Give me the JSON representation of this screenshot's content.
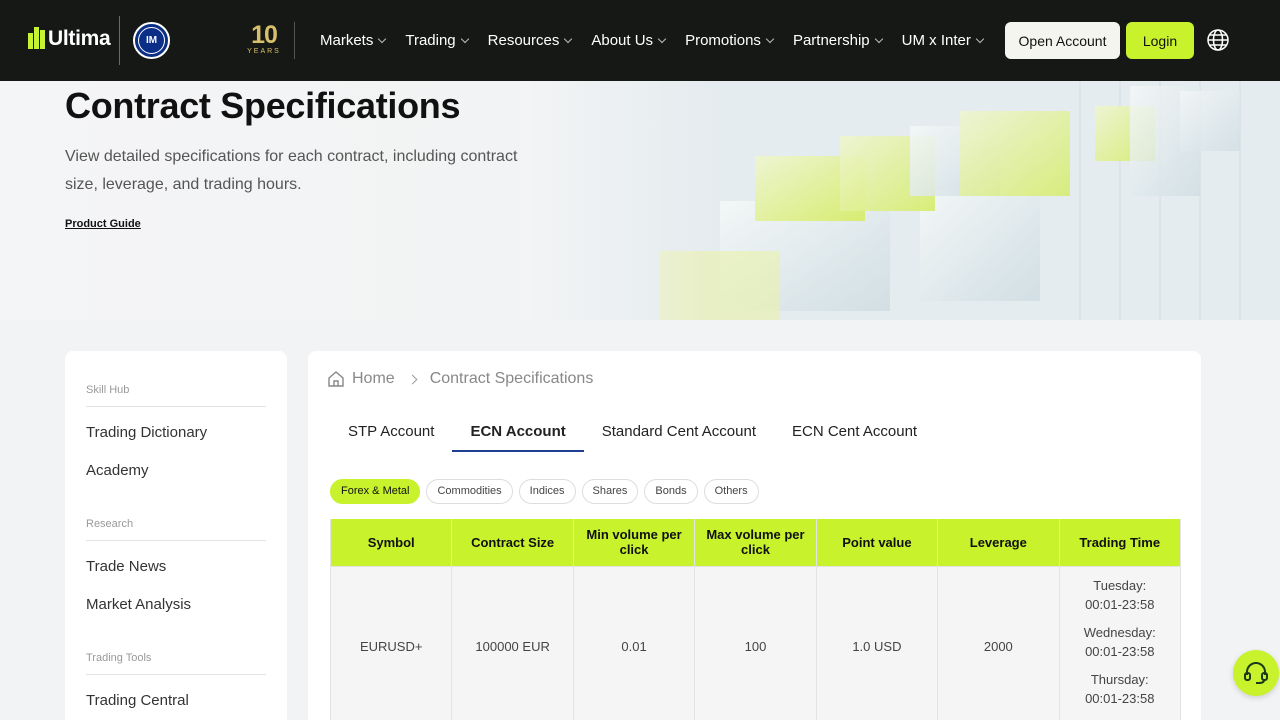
{
  "brand": {
    "name": "Ultima",
    "partner_badge": "IM",
    "anniversary_num": "10",
    "anniversary_text": "YEARS"
  },
  "nav": {
    "items": [
      {
        "label": "Markets"
      },
      {
        "label": "Trading"
      },
      {
        "label": "Resources"
      },
      {
        "label": "About Us"
      },
      {
        "label": "Promotions"
      },
      {
        "label": "Partnership"
      },
      {
        "label": "UM x Inter"
      }
    ],
    "open_account": "Open Account",
    "login": "Login"
  },
  "hero": {
    "title": "Contract Specifications",
    "description": "View detailed specifications for each contract, including contract size, leverage, and trading hours.",
    "guide_link": "Product Guide"
  },
  "sidebar": {
    "sections": [
      {
        "title": "Skill Hub",
        "items": [
          "Trading Dictionary",
          "Academy"
        ]
      },
      {
        "title": "Research",
        "items": [
          "Trade News",
          "Market Analysis"
        ]
      },
      {
        "title": "Trading Tools",
        "items": [
          "Trading Central"
        ]
      }
    ]
  },
  "breadcrumb": {
    "home": "Home",
    "current": "Contract Specifications"
  },
  "tabs": [
    "STP Account",
    "ECN Account",
    "Standard Cent Account",
    "ECN Cent Account"
  ],
  "active_tab": "ECN Account",
  "filters": [
    "Forex & Metal",
    "Commodities",
    "Indices",
    "Shares",
    "Bonds",
    "Others"
  ],
  "active_filter": "Forex & Metal",
  "table": {
    "headers": [
      "Symbol",
      "Contract Size",
      "Min volume per click",
      "Max volume per click",
      "Point value",
      "Leverage",
      "Trading Time"
    ],
    "rows": [
      {
        "symbol": "EURUSD+",
        "contract_size": "100000 EUR",
        "min_volume": "0.01",
        "max_volume": "100",
        "point_value": "1.0 USD",
        "leverage": "2000",
        "trading_time": [
          {
            "day": "Tuesday:",
            "hours": "00:01-23:58"
          },
          {
            "day": "Wednesday:",
            "hours": "00:01-23:58"
          },
          {
            "day": "Thursday:",
            "hours": "00:01-23:58"
          }
        ]
      }
    ]
  },
  "colors": {
    "accent": "#c8f22c",
    "nav_bg": "#161815",
    "tab_underline": "#1f3f93"
  },
  "icons": [
    "globe-icon",
    "home-icon",
    "chevron-down-icon",
    "chevron-right-icon",
    "support-headset-icon"
  ]
}
